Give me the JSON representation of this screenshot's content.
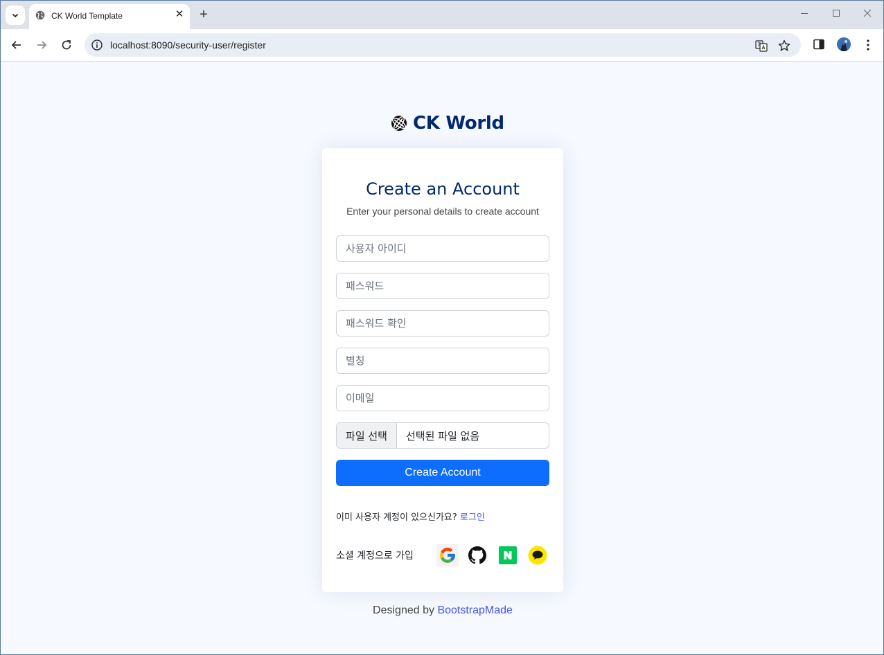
{
  "browser": {
    "tab_title": "CK World Template",
    "new_tab": "+",
    "tab_close": "✕",
    "url": "localhost:8090/security-user/register"
  },
  "page": {
    "logo_text": "CK World",
    "card": {
      "title": "Create an Account",
      "subtitle": "Enter your personal details to create account",
      "fields": {
        "username_placeholder": "사용자 아이디",
        "password_placeholder": "패스워드",
        "password_confirm_placeholder": "패스워드 확인",
        "nickname_placeholder": "별칭",
        "email_placeholder": "이메일"
      },
      "file": {
        "button_label": "파일 선택",
        "status": "선택된 파일 없음"
      },
      "submit_label": "Create Account",
      "login_prompt": "이미 사용자 계정이 있으신가요?",
      "login_link": "로그인",
      "social_label": "소셜 계정으로 가입",
      "social_icons": [
        "google-icon",
        "github-icon",
        "naver-icon",
        "kakao-icon"
      ]
    },
    "credits_prefix": "Designed by",
    "credits_link": "BootstrapMade"
  },
  "colors": {
    "brand_navy": "#012970",
    "primary_button": "#0d6efd",
    "link": "#4154f1",
    "page_bg": "#f6f9ff"
  }
}
